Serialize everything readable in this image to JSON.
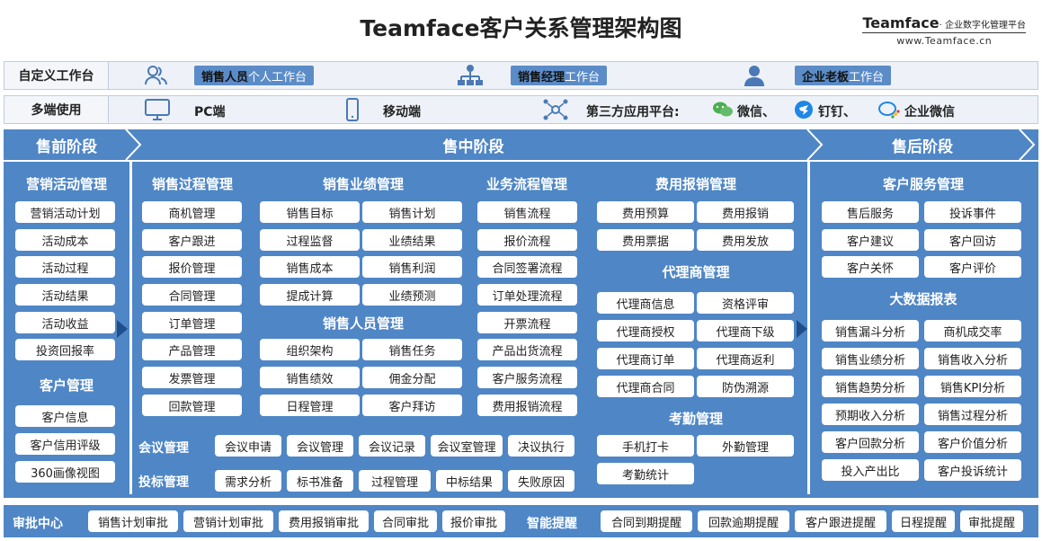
{
  "title": "Teamface客户关系管理架构图",
  "brand": {
    "name": "Teamface",
    "tagline": "· 企业数字化管理平台",
    "url": "www.Teamface.cn"
  },
  "workspace": {
    "label": "自定义工作台",
    "items": [
      {
        "bold": "销售人员",
        "rest": "个人工作台",
        "icon": "person-outline-icon"
      },
      {
        "bold": "销售经理",
        "rest": "工作台",
        "icon": "org-chart-icon"
      },
      {
        "bold": "企业老板",
        "rest": "工作台",
        "icon": "person-solid-icon"
      }
    ]
  },
  "multi": {
    "label": "多端使用",
    "pc": "PC端",
    "mobile": "移动端",
    "third_label": "第三方应用平台:",
    "wechat": "微信、",
    "dingtalk": "钉钉、",
    "wecom": "企业微信"
  },
  "phases": {
    "pre": "售前阶段",
    "mid": "售中阶段",
    "post": "售后阶段"
  },
  "pre": {
    "marketing": {
      "title": "营销活动管理",
      "items": [
        "营销活动计划",
        "活动成本",
        "活动过程",
        "活动结果",
        "活动收益",
        "投资回报率"
      ]
    },
    "customer": {
      "title": "客户管理",
      "items": [
        "客户信息",
        "客户信用评级",
        "360画像视图"
      ]
    }
  },
  "mid": {
    "process": {
      "title": "销售过程管理",
      "items": [
        "商机管理",
        "客户跟进",
        "报价管理",
        "合同管理",
        "订单管理",
        "产品管理",
        "发票管理",
        "回款管理"
      ]
    },
    "perf": {
      "title": "销售业绩管理",
      "items": [
        "销售目标",
        "销售计划",
        "过程监督",
        "业绩结果",
        "销售成本",
        "销售利润",
        "提成计算",
        "业绩预测"
      ]
    },
    "staff": {
      "title": "销售人员管理",
      "items": [
        "组织架构",
        "销售任务",
        "销售绩效",
        "佣金分配",
        "日程管理",
        "客户拜访"
      ]
    },
    "flow": {
      "title": "业务流程管理",
      "items": [
        "销售流程",
        "报价流程",
        "合同签署流程",
        "订单处理流程",
        "开票流程",
        "产品出货流程",
        "客户服务流程",
        "费用报销流程"
      ]
    },
    "expense": {
      "title": "费用报销管理",
      "items": [
        "费用预算",
        "费用报销",
        "费用票据",
        "费用发放"
      ]
    },
    "agent": {
      "title": "代理商管理",
      "items": [
        "代理商信息",
        "资格评审",
        "代理商授权",
        "代理商下级",
        "代理商订单",
        "代理商返利",
        "代理商合同",
        "防伪溯源"
      ]
    },
    "attend": {
      "title": "考勤管理",
      "items": [
        "手机打卡",
        "外勤管理",
        "考勤统计"
      ]
    },
    "meeting": {
      "title": "会议管理",
      "items": [
        "会议申请",
        "会议管理",
        "会议记录",
        "会议室管理",
        "决议执行"
      ]
    },
    "bid": {
      "title": "投标管理",
      "items": [
        "需求分析",
        "标书准备",
        "过程管理",
        "中标结果",
        "失败原因"
      ]
    }
  },
  "post": {
    "service": {
      "title": "客户服务管理",
      "items": [
        "售后服务",
        "投诉事件",
        "客户建议",
        "客户回访",
        "客户关怀",
        "客户评价"
      ]
    },
    "bigdata": {
      "title": "大数据报表",
      "items": [
        "销售漏斗分析",
        "商机成交率",
        "销售业绩分析",
        "销售收入分析",
        "销售趋势分析",
        "销售KPI分析",
        "预期收入分析",
        "销售过程分析",
        "客户回款分析",
        "客户价值分析",
        "投入产出比",
        "客户投诉统计"
      ]
    }
  },
  "approval": {
    "title": "审批中心",
    "items": [
      "销售计划审批",
      "营销计划审批",
      "费用报销审批",
      "合同审批",
      "报价审批"
    ]
  },
  "reminder": {
    "title": "智能提醒",
    "items": [
      "合同到期提醒",
      "回款逾期提醒",
      "客户跟进提醒",
      "日程提醒",
      "审批提醒"
    ]
  },
  "colors": {
    "main_blue": "#4f86c6",
    "pill_blue": "#5b8cc7",
    "arrow_dark": "#1f4f8a"
  }
}
